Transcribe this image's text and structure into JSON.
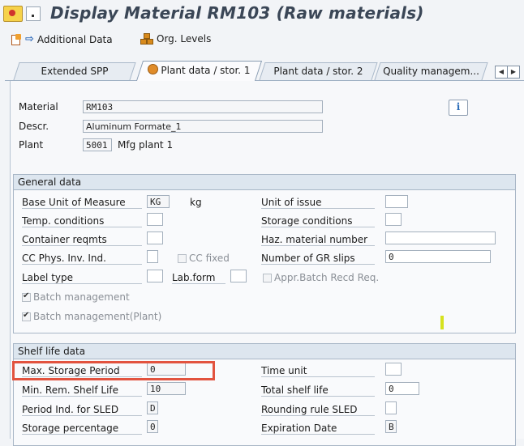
{
  "window": {
    "title": "Display Material RM103 (Raw materials)"
  },
  "toolbar": {
    "additional_data": "Additional Data",
    "org_levels": "Org. Levels"
  },
  "tabs": [
    {
      "label": "Extended SPP",
      "active": false
    },
    {
      "label": "Plant data / stor. 1",
      "active": true
    },
    {
      "label": "Plant data / stor. 2",
      "active": false
    },
    {
      "label": "Quality managem...",
      "active": false
    }
  ],
  "header": {
    "material_label": "Material",
    "material_value": "RM103",
    "descr_label": "Descr.",
    "descr_value": "Aluminum Formate_1",
    "plant_label": "Plant",
    "plant_value": "5001",
    "plant_name": "Mfg plant 1"
  },
  "general": {
    "title": "General data",
    "base_uom_label": "Base Unit of Measure",
    "base_uom_value": "KG",
    "base_uom_text": "kg",
    "unit_issue_label": "Unit of issue",
    "unit_issue_value": "",
    "temp_label": "Temp. conditions",
    "temp_value": "",
    "storage_cond_label": "Storage conditions",
    "storage_cond_value": "",
    "container_label": "Container reqmts",
    "container_value": "",
    "haz_label": "Haz. material number",
    "haz_value": "",
    "cc_phys_label": "CC Phys. Inv. Ind.",
    "cc_phys_value": "",
    "cc_fixed_label": "CC fixed",
    "gr_slips_label": "Number of GR slips",
    "gr_slips_value": "0",
    "label_type_label": "Label type",
    "label_type_value": "",
    "lab_form_label": "Lab.form",
    "lab_form_value": "",
    "appr_batch_label": "Appr.Batch Recd Req.",
    "batch_mgmt_label": "Batch management",
    "batch_mgmt_plant_label": "Batch management(Plant)"
  },
  "shelf": {
    "title": "Shelf life data",
    "max_storage_label": "Max. Storage Period",
    "max_storage_value": "0",
    "time_unit_label": "Time unit",
    "time_unit_value": "",
    "min_rem_label": "Min. Rem. Shelf Life",
    "min_rem_value": "10",
    "total_label": "Total shelf life",
    "total_value": "0",
    "period_ind_label": "Period Ind. for SLED",
    "period_ind_value": "D",
    "rounding_label": "Rounding rule SLED",
    "rounding_value": "",
    "storage_pct_label": "Storage percentage",
    "storage_pct_value": "0",
    "expiration_label": "Expiration Date",
    "expiration_value": "B"
  },
  "colors": {
    "highlight": "#e2533f",
    "accent": "#2b6cb8",
    "marker": "#d6e21f"
  }
}
